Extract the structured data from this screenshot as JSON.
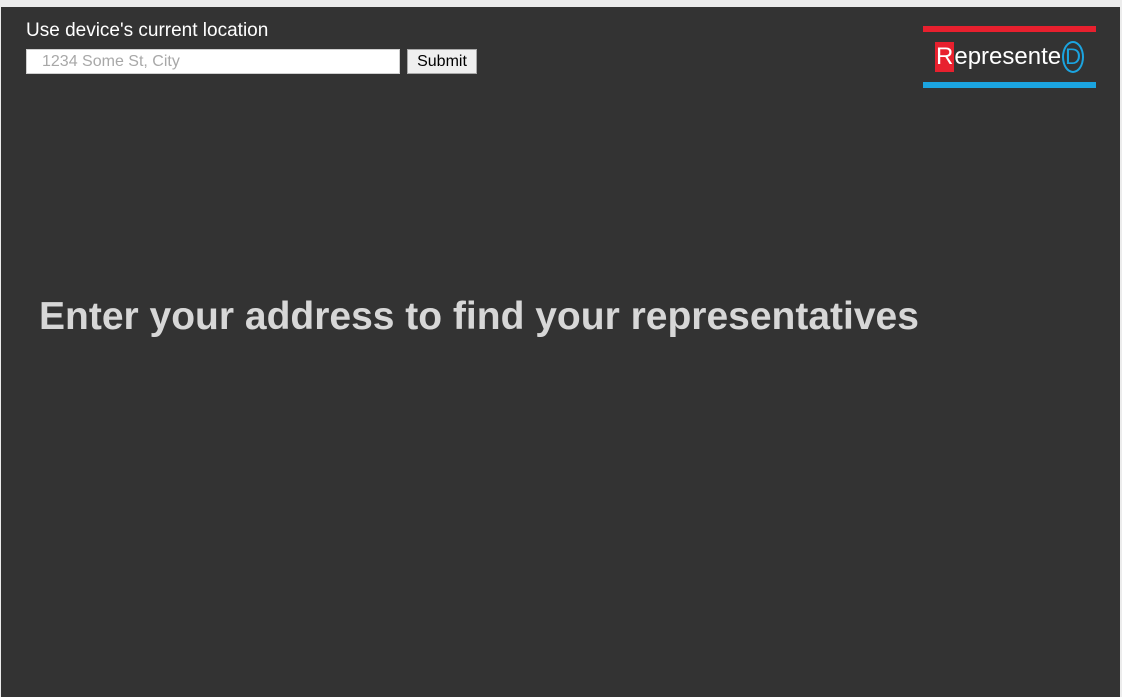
{
  "header": {
    "location_link": "Use device's current location",
    "address_placeholder": "1234 Some St, City",
    "address_value": "",
    "submit_label": "Submit"
  },
  "logo": {
    "first_letter": "R",
    "middle": "epresente",
    "last_letter": "D",
    "colors": {
      "red": "#e8202e",
      "blue": "#1ba4e0"
    }
  },
  "main": {
    "headline": "Enter your address to find your representatives"
  },
  "colors": {
    "background": "#333333",
    "headline": "#d7d7d7"
  }
}
